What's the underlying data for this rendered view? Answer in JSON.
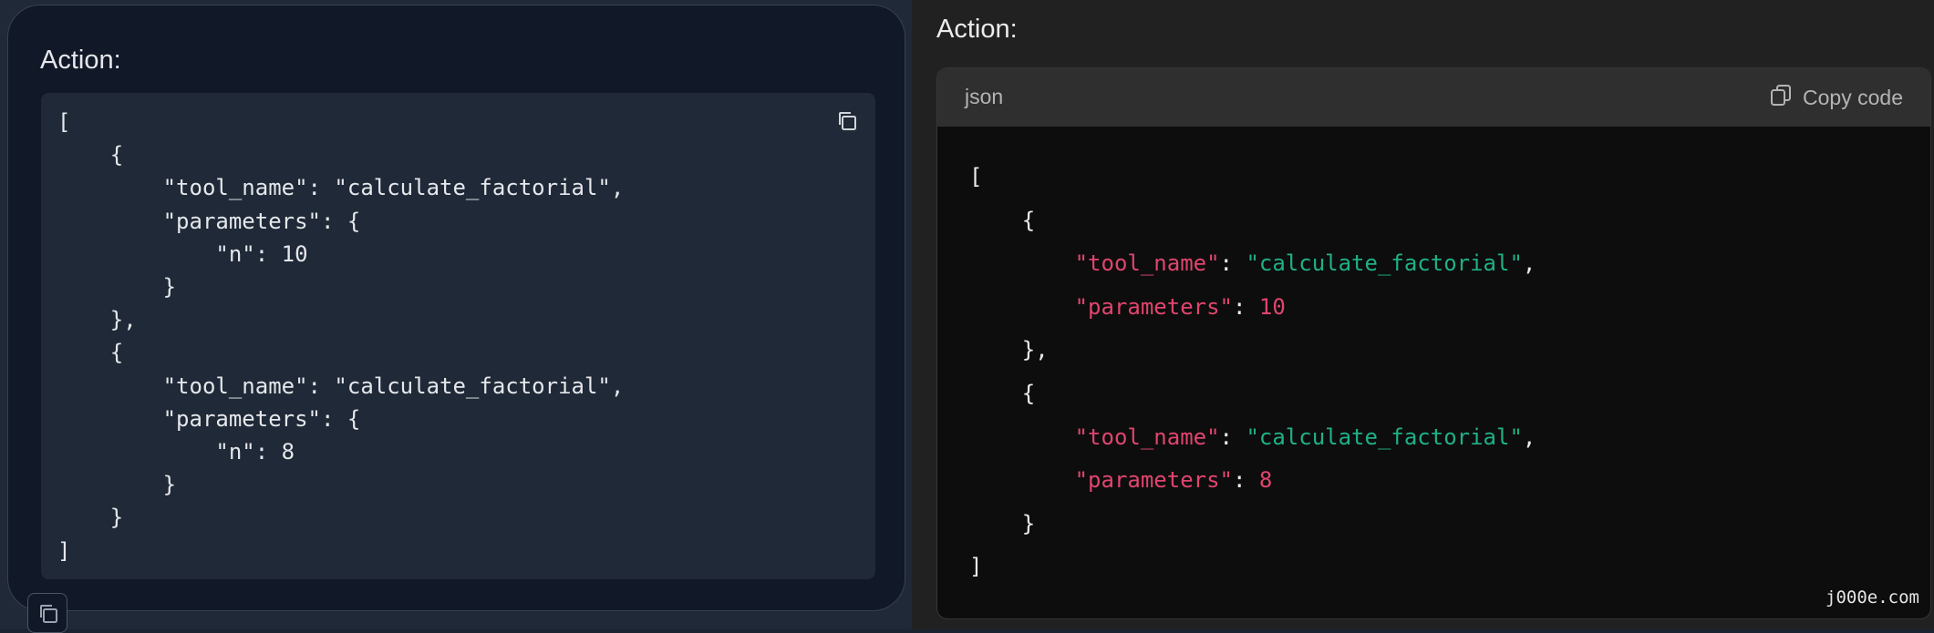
{
  "left": {
    "title": "Action:",
    "code": "[\n    {\n        \"tool_name\": \"calculate_factorial\",\n        \"parameters\": {\n            \"n\": 10\n        }\n    },\n    {\n        \"tool_name\": \"calculate_factorial\",\n        \"parameters\": {\n            \"n\": 8\n        }\n    }\n]"
  },
  "right": {
    "title": "Action:",
    "language": "json",
    "copy_label": "Copy code",
    "code": {
      "open_bracket": "[",
      "obj1_open": "{",
      "obj1_key1": "\"tool_name\"",
      "obj1_val1": "\"calculate_factorial\"",
      "obj1_key2": "\"parameters\"",
      "obj1_val2": "10",
      "obj1_close": "},",
      "obj2_open": "{",
      "obj2_key1": "\"tool_name\"",
      "obj2_val1": "\"calculate_factorial\"",
      "obj2_key2": "\"parameters\"",
      "obj2_val2": "8",
      "obj2_close": "}",
      "close_bracket": "]"
    },
    "watermark": "j000e.com"
  },
  "icons": [
    "copy-icon"
  ],
  "colors": {
    "json_key": "#e0456e",
    "json_string": "#1fb087",
    "json_number": "#e0456e"
  }
}
